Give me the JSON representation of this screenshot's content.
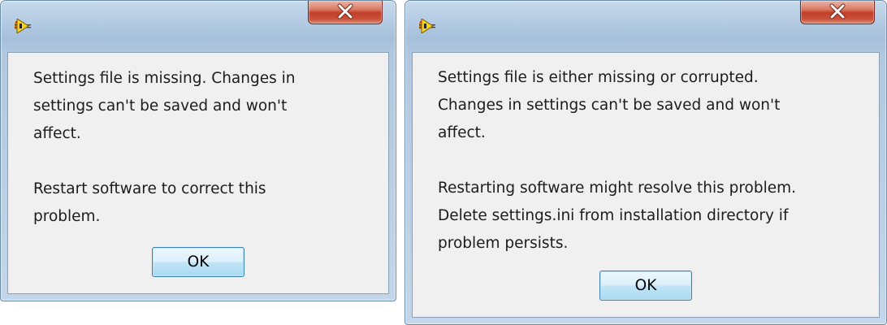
{
  "dialogs": [
    {
      "icon": "labview-app-icon",
      "close_icon": "close-icon",
      "message_lines": [
        "Settings file is missing. Changes in",
        "settings can't be saved and won't",
        "affect.",
        "",
        "Restart software to correct this",
        "problem."
      ],
      "ok_label": "OK"
    },
    {
      "icon": "labview-app-icon",
      "close_icon": "close-icon",
      "message_lines": [
        "Settings file is either missing or corrupted.",
        "Changes in settings can't be saved and won't",
        "affect.",
        "",
        "Restarting software might resolve this problem.",
        "Delete settings.ini from installation directory if",
        "problem persists."
      ],
      "ok_label": "OK"
    }
  ],
  "colors": {
    "frame": "#b4cbe3",
    "client_bg": "#f0f0f0",
    "close_red": "#c1402a",
    "ok_blue": "#a9daf3"
  }
}
